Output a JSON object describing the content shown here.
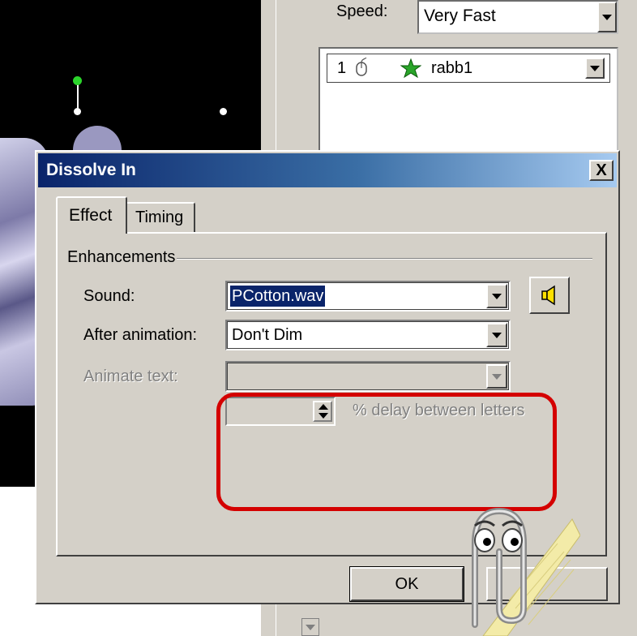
{
  "task_pane": {
    "speed_label": "Speed:",
    "speed_value": "Very Fast",
    "animation_list": [
      {
        "order": "1",
        "trigger_icon": "mouse-icon",
        "effect_icon": "star-icon",
        "name": "rabb1"
      }
    ]
  },
  "dialog": {
    "title": "Dissolve In",
    "close_label": "X",
    "tabs": [
      {
        "label": "Effect",
        "selected": true
      },
      {
        "label": "Timing",
        "selected": false
      }
    ],
    "group_label": "Enhancements",
    "sound": {
      "label": "Sound:",
      "value": "PCotton.wav"
    },
    "after_animation": {
      "label": "After animation:",
      "value": "Don't Dim"
    },
    "animate_text": {
      "label": "Animate text:",
      "value": "",
      "disabled": true
    },
    "delay": {
      "value": "",
      "label": "% delay between letters",
      "disabled": true
    },
    "ok_label": "OK"
  },
  "annotation": {
    "highlight_color": "#d40000"
  },
  "colors": {
    "titlebar_start": "#0a246a",
    "titlebar_end": "#a6caf0",
    "face": "#d4d0c8"
  }
}
